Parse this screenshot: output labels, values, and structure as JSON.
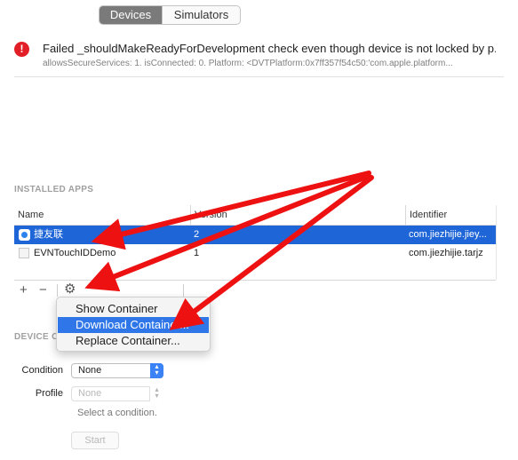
{
  "tabs": {
    "devices": "Devices",
    "simulators": "Simulators"
  },
  "error": {
    "icon": "!",
    "title": "Failed _shouldMakeReadyForDevelopment check even though device is not locked by p...",
    "detail": "allowsSecureServices: 1. isConnected: 0. Platform: <DVTPlatform:0x7ff357f54c50:'com.apple.platform..."
  },
  "installed_apps": {
    "title": "INSTALLED APPS",
    "columns": {
      "name": "Name",
      "version": "Version",
      "identifier": "Identifier"
    },
    "rows": [
      {
        "name": "捷友联",
        "version": "2",
        "identifier": "com.jiezhijie.jiey..."
      },
      {
        "name": "EVNTouchIDDemo",
        "version": "1",
        "identifier": "com.jiezhijie.tarjz"
      }
    ]
  },
  "toolbar": {
    "add": "+",
    "remove": "−",
    "gear": "⚙"
  },
  "menu": {
    "items": [
      "Show Container",
      "Download Container...",
      "Replace Container..."
    ],
    "highlighted_index": 1
  },
  "device_conditions": {
    "title": "DEVICE C",
    "condition_label": "Condition",
    "condition_value": "None",
    "profile_label": "Profile",
    "profile_value": "None",
    "hint": "Select a condition.",
    "start_label": "Start"
  },
  "colors": {
    "arrow": "#ee1111",
    "selection": "#1e65d7",
    "menu_highlight": "#2f77e8",
    "error": "#e21f26"
  }
}
